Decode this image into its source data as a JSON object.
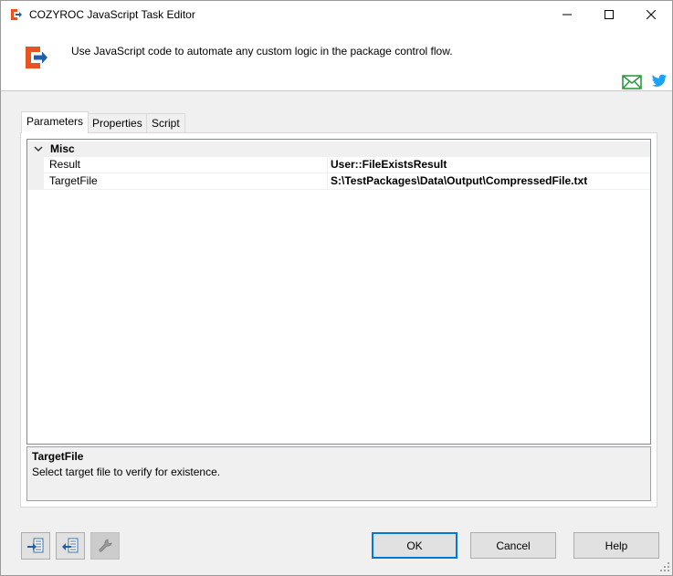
{
  "window": {
    "title": "COZYROC JavaScript Task Editor"
  },
  "header": {
    "description": "Use JavaScript code to automate any custom logic in the package control flow."
  },
  "tabs": [
    {
      "label": "Parameters",
      "active": true
    },
    {
      "label": "Properties",
      "active": false
    },
    {
      "label": "Script",
      "active": false
    }
  ],
  "grid": {
    "category": "Misc",
    "properties": [
      {
        "name": "Result",
        "value": "User::FileExistsResult"
      },
      {
        "name": "TargetFile",
        "value": "S:\\TestPackages\\Data\\Output\\CompressedFile.txt"
      }
    ]
  },
  "description_pane": {
    "title": "TargetFile",
    "text": "Select target file to verify for existence."
  },
  "buttons": {
    "ok": "OK",
    "cancel": "Cancel",
    "help": "Help"
  },
  "colors": {
    "brand_orange": "#e8541e",
    "brand_blue": "#1f5fa8",
    "mail_green": "#2e9a3e",
    "twitter_blue": "#1da1f2",
    "default_button_border": "#0078d7"
  }
}
